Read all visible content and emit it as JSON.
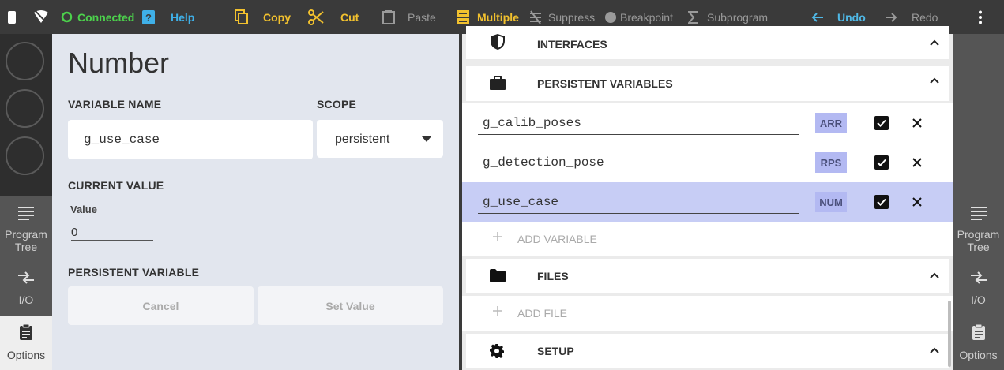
{
  "toolbar": {
    "connected_label": "Connected",
    "help_label": "Help",
    "copy_label": "Copy",
    "cut_label": "Cut",
    "paste_label": "Paste",
    "multiple_label": "Multiple",
    "suppress_label": "Suppress",
    "breakpoint_label": "Breakpoint",
    "subprogram_label": "Subprogram",
    "undo_label": "Undo",
    "redo_label": "Redo"
  },
  "left_nav": {
    "program_tree_label": "Program Tree",
    "io_label": "I/O",
    "options_label": "Options"
  },
  "right_nav": {
    "program_tree_label": "Program Tree",
    "io_label": "I/O",
    "options_label": "Options"
  },
  "detail": {
    "title": "Number",
    "variable_name_label": "VARIABLE NAME",
    "variable_name_value": "g_use_case",
    "scope_label": "SCOPE",
    "scope_value": "persistent",
    "current_value_label": "CURRENT VALUE",
    "value_label": "Value",
    "value": "0",
    "persistent_variable_label": "PERSISTENT VARIABLE",
    "cancel_label": "Cancel",
    "set_value_label": "Set Value"
  },
  "sections": {
    "interfaces": "INTERFACES",
    "persistent_variables": "PERSISTENT VARIABLES",
    "files": "FILES",
    "setup": "SETUP"
  },
  "variables": [
    {
      "name": "g_calib_poses",
      "type": "ARR"
    },
    {
      "name": "g_detection_pose",
      "type": "RPS"
    },
    {
      "name": "g_use_case",
      "type": "NUM"
    }
  ],
  "add_variable_label": "ADD VARIABLE",
  "add_file_label": "ADD FILE",
  "colors": {
    "toolbar_bg": "#3a3a3a",
    "connected": "#4cd14c",
    "help": "#3fb0e8",
    "accent_yellow": "#f2c12e",
    "undo": "#4fb8e6",
    "selected_row": "#c7cdf5",
    "type_badge": "#b3b9f2"
  }
}
